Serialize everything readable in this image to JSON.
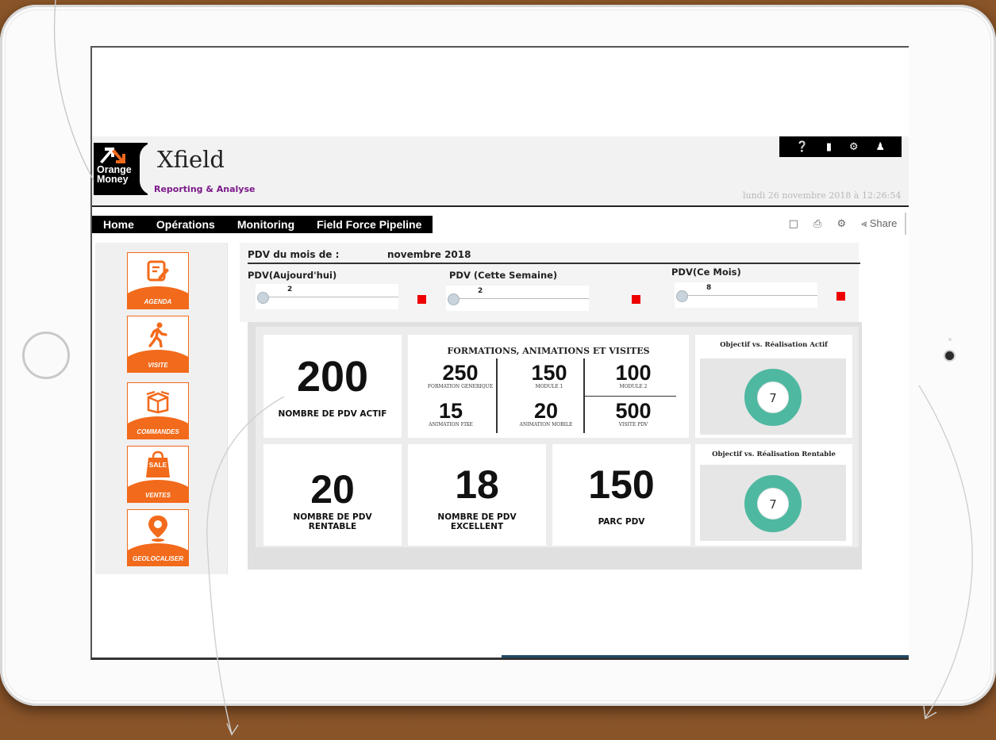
{
  "app": {
    "logo_text_1": "Orange",
    "logo_text_2": "Money",
    "brand": "Xfield",
    "subtitle": "Reporting & Analyse",
    "datetime": "lundi 26 novembre 2018 à 12:26:54"
  },
  "header_icons": [
    "help-icon",
    "book-icon",
    "settings-icon",
    "user-icon"
  ],
  "nav": [
    "Home",
    "Opérations",
    "Monitoring",
    "Field Force Pipeline"
  ],
  "toolbar": {
    "share_label": "Share",
    "icons": [
      "screen-icon",
      "print-icon",
      "gear-icon",
      "share-icon"
    ]
  },
  "sidebar": [
    {
      "label": "AGENDA",
      "icon": "edit-icon"
    },
    {
      "label": "VISITE",
      "icon": "walking-person-icon"
    },
    {
      "label": "COMMANDES",
      "icon": "box-icon"
    },
    {
      "label": "VENTES",
      "icon": "sale-bag-icon",
      "badge": "SALE"
    },
    {
      "label": "GEOLOCALISER",
      "icon": "location-pin-icon"
    }
  ],
  "pdv": {
    "title": "PDV du mois de :",
    "month": "novembre 2018",
    "sliders": [
      {
        "label": "PDV(Aujourd'hui)",
        "value": "2"
      },
      {
        "label": "PDV (Cette Semaine)",
        "value": "2"
      },
      {
        "label": "PDV(Ce Mois)",
        "value": "8"
      }
    ]
  },
  "kpis": {
    "actif_value": "200",
    "actif_label": "NOMBRE DE PDV ACTIF",
    "rentable_value": "20",
    "rentable_label_1": "NOMBRE DE PDV",
    "rentable_label_2": "RENTABLE",
    "excellent_value": "18",
    "excellent_label_1": "NOMBRE DE PDV",
    "excellent_label_2": "EXCELLENT",
    "parc_value": "150",
    "parc_label": "PARC PDV"
  },
  "formations": {
    "title": "FORMATIONS, ANIMATIONS ET VISITES",
    "cells": [
      {
        "value": "250",
        "label": "FORMATION GENERIQUE"
      },
      {
        "value": "150",
        "label": "MODULE 1"
      },
      {
        "value": "100",
        "label": "MODULE 2"
      },
      {
        "value": "15",
        "label": "ANIMATION FIXE"
      },
      {
        "value": "20",
        "label": "ANIMATION MOBILE"
      },
      {
        "value": "500",
        "label": "VISITE PDV"
      }
    ]
  },
  "donuts": [
    {
      "title": "Objectif vs. Réalisation Actif",
      "value": "7"
    },
    {
      "title": "Objectif vs. Réalisation Rentable",
      "value": "7"
    }
  ],
  "colors": {
    "accent": "#f26a1b",
    "donut": "#4fb8a1",
    "status": "#e00000"
  }
}
